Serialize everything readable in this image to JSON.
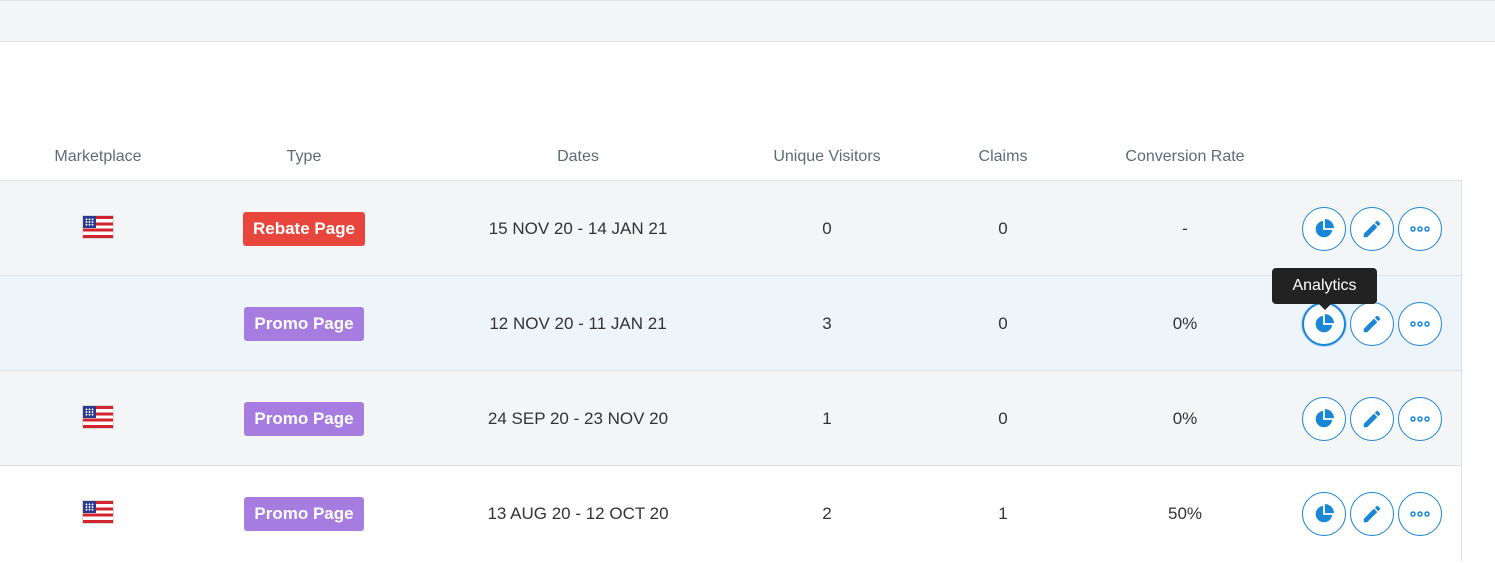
{
  "table": {
    "headers": {
      "marketplace": "Marketplace",
      "type": "Type",
      "dates": "Dates",
      "visitors": "Unique Visitors",
      "claims": "Claims",
      "conversion": "Conversion Rate"
    },
    "rows": [
      {
        "marketplace_flag": "us-flag-icon",
        "type": "Rebate Page",
        "type_color": "#e8453c",
        "dates": "15 NOV 20 - 14 JAN 21",
        "visitors": "0",
        "claims": "0",
        "conversion": "-"
      },
      {
        "marketplace_flag": "",
        "type": "Promo Page",
        "type_color": "#a77ce0",
        "dates": "12 NOV 20 - 11 JAN 21",
        "visitors": "3",
        "claims": "0",
        "conversion": "0%"
      },
      {
        "marketplace_flag": "us-flag-icon",
        "type": "Promo Page",
        "type_color": "#a77ce0",
        "dates": "24 SEP 20 - 23 NOV 20",
        "visitors": "1",
        "claims": "0",
        "conversion": "0%"
      },
      {
        "marketplace_flag": "us-flag-icon",
        "type": "Promo Page",
        "type_color": "#a77ce0",
        "dates": "13 AUG 20 - 12 OCT 20",
        "visitors": "2",
        "claims": "1",
        "conversion": "50%"
      }
    ],
    "actions": {
      "analytics_icon": "pie-chart-icon",
      "edit_icon": "pencil-icon",
      "more_icon": "more-horizontal-icon"
    }
  },
  "tooltip": {
    "text": "Analytics"
  },
  "colors": {
    "accent": "#1a86d6",
    "rebate": "#e8453c",
    "promo": "#a77ce0"
  }
}
